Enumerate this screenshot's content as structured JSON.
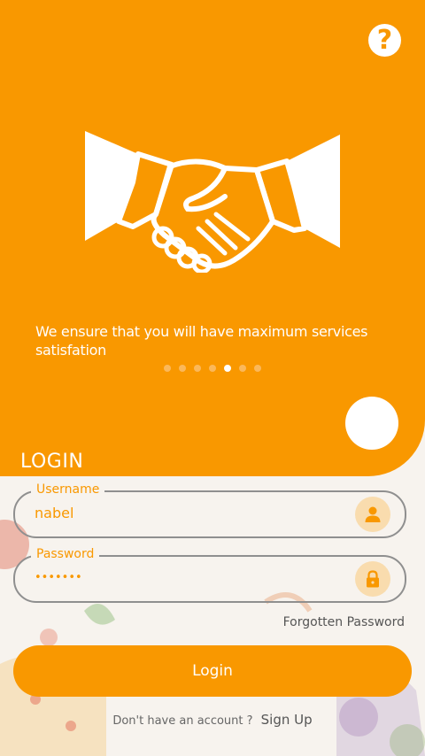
{
  "header": {
    "help_icon": "question-mark-icon",
    "help_glyph": "?"
  },
  "carousel": {
    "illustration_icon": "handshake-icon",
    "slogan": "We ensure that you will have maximum services satisfation",
    "page_count": 7,
    "active_index": 4
  },
  "login": {
    "title": "LOGIN",
    "username": {
      "label": "Username",
      "value": "nabel",
      "icon": "person-icon"
    },
    "password": {
      "label": "Password",
      "value": "•••••••",
      "icon": "lock-icon"
    },
    "forgot_label": "Forgotten Password",
    "submit_label": "Login",
    "signup_prompt": "Don't have an account ?",
    "signup_label": "Sign Up"
  },
  "colors": {
    "accent": "#f99800",
    "accent_light": "#f9dcae",
    "background": "#f7f3ee"
  }
}
